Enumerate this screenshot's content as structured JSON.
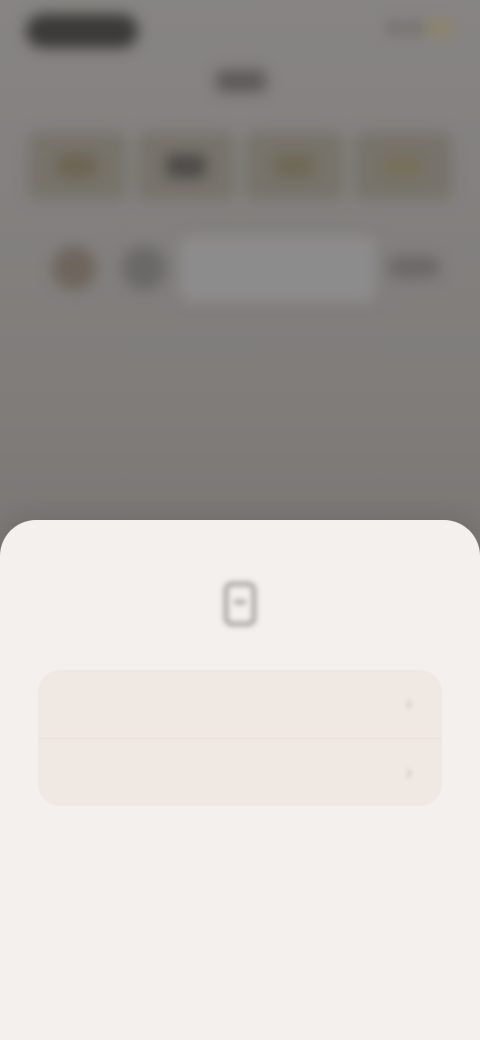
{
  "status_bar": {
    "pill_color": "#3b3a38",
    "indicators": [
      "signal-icon",
      "wifi-icon",
      "battery-icon"
    ]
  },
  "background": {
    "title_placeholder": "",
    "tiles": [
      {
        "name": "tile-1",
        "icon": "category-icon"
      },
      {
        "name": "tile-2",
        "icon": "category-icon"
      },
      {
        "name": "tile-3",
        "icon": "category-icon"
      },
      {
        "name": "tile-4",
        "icon": "category-icon"
      }
    ],
    "search_row": {
      "avatar_icons": [
        "avatar-icon",
        "avatar-icon"
      ],
      "field_value": "",
      "action_icon": "action-icon"
    },
    "overlay_color": "#7d7a78"
  },
  "sheet": {
    "header_icon": "document-icon",
    "options": [
      {
        "label": "",
        "icon": "chevron-right-icon"
      },
      {
        "label": "",
        "icon": "chevron-right-icon"
      }
    ],
    "colors": {
      "sheet_bg": "#f3f0ed",
      "card_bg": "#f0e8e3"
    }
  }
}
